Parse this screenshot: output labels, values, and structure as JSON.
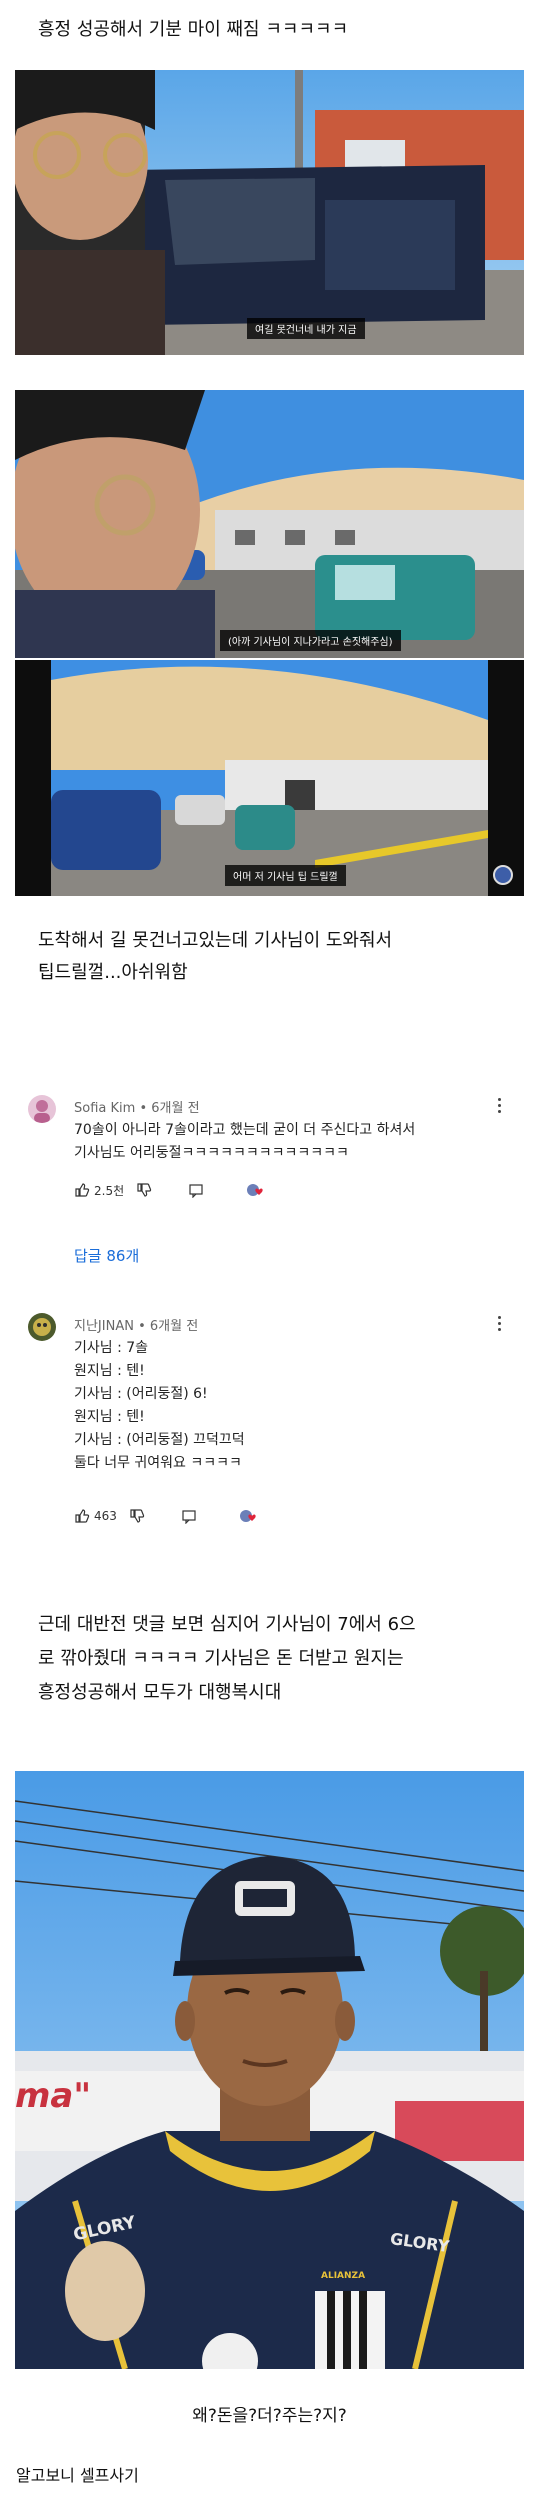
{
  "post": {
    "caption_1": "흥정 성공해서 기분 마이 째짐 ㅋㅋㅋㅋㅋ",
    "caption_2": "도착해서 길 못건너고있는데 기사님이 도와줘서\n팁드릴껄...아쉬워함",
    "caption_3": "근데 대반전 댓글 보면 심지어 기사님이 7에서 6으\n로 깎아줬대 ㅋㅋㅋㅋ 기사님은 돈 더받고 원지는\n흥정성공해서 모두가 대행복시대",
    "caption_4": "왜?돈을?더?주는?지?",
    "caption_5": "알고보니 셀프사기"
  },
  "videos": {
    "frame_1_subtitle": "여길 못건너네 내가 지금",
    "frame_2_subtitle": "(아까 기사님이 지나가라고 손짓해주심)",
    "frame_3_subtitle": "어머 저 기사님 팁 드릴껄"
  },
  "comments": [
    {
      "author": "Sofia Kim",
      "time": "6개월 전",
      "body": "70솔이 아니라 7솔이라고 했는데 굳이 더 주신다고 하셔서\n기사님도 어리둥절ㅋㅋㅋㅋㅋㅋㅋㅋㅋㅋㅋㅋㅋ",
      "likes": "2.5천",
      "replies_label": "답글 86개"
    },
    {
      "author": "지난JINAN",
      "time": "6개월 전",
      "body": "기사님 : 7솔\n원지님 : 텐!\n기사님 : (어리둥절) 6!\n원지님 : 텐!\n기사님 : (어리둥절) 끄덕끄덕\n둘다 너무 귀여워요 ㅋㅋㅋㅋ",
      "likes": "463"
    }
  ],
  "shirt": {
    "brand_left": "GLORY",
    "brand_right": "GLORY",
    "cap_logo": "ALIANZA",
    "sign_text": "ma\""
  },
  "colors": {
    "link_blue": "#1a6dd9",
    "subtitle_bg": "#000000",
    "text": "#111111"
  }
}
